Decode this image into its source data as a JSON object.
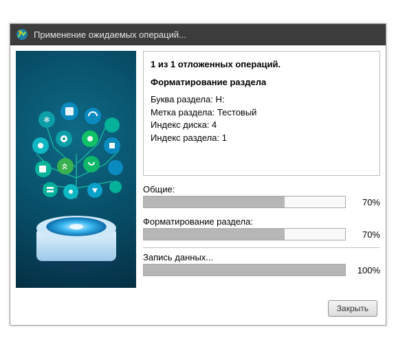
{
  "window": {
    "title": "Применение ожидаемых операций..."
  },
  "info": {
    "summary": "1 из 1 отложенных операций.",
    "operation": "Форматирование раздела",
    "details": [
      {
        "label": "Буква раздела",
        "value": "H:"
      },
      {
        "label": "Метка раздела",
        "value": "Тестовый"
      },
      {
        "label": "Индекс диска",
        "value": "4"
      },
      {
        "label": "Индекс раздела",
        "value": "1"
      }
    ]
  },
  "progress": {
    "overall": {
      "label": "Общие:",
      "pct": 70
    },
    "task": {
      "label": "Форматирование раздела:",
      "pct": 70
    },
    "write": {
      "label": "Запись данных...",
      "pct": 100
    }
  },
  "buttons": {
    "close": "Закрыть"
  }
}
